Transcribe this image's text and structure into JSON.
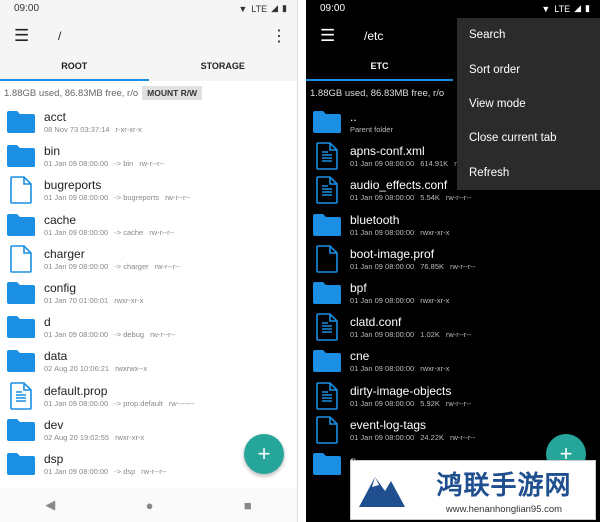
{
  "left": {
    "status_time": "09:00",
    "status_net": "LTE",
    "path": "/",
    "tabs": [
      "ROOT",
      "STORAGE"
    ],
    "storage_info": "1.88GB used, 86.83MB free, r/o",
    "mount_button": "MOUNT R/W",
    "files": [
      {
        "name": "acct",
        "type": "folder",
        "date": "08 Nov 73 03:37:14",
        "link": "",
        "perm": "r-xr-xr-x"
      },
      {
        "name": "bin",
        "type": "folder",
        "date": "01 Jan 09 08:00:00",
        "link": "-> bin",
        "perm": "rw-r--r--"
      },
      {
        "name": "bugreports",
        "type": "file",
        "date": "01 Jan 09 08:00:00",
        "link": "-> bugreports",
        "perm": "rw-r--r--"
      },
      {
        "name": "cache",
        "type": "folder",
        "date": "01 Jan 09 08:00:00",
        "link": "-> cache",
        "perm": "rw-r--r--"
      },
      {
        "name": "charger",
        "type": "file",
        "date": "01 Jan 09 08:00:00",
        "link": "-> charger",
        "perm": "rw-r--r--"
      },
      {
        "name": "config",
        "type": "folder",
        "date": "01 Jan 70 01:00:01",
        "link": "",
        "perm": "rwxr-xr-x"
      },
      {
        "name": "d",
        "type": "folder",
        "date": "01 Jan 09 08:00:00",
        "link": "-> debug",
        "perm": "rw-r--r--"
      },
      {
        "name": "data",
        "type": "folder",
        "date": "02 Aug 20 10:06:21",
        "link": "",
        "perm": "rwxrwx--x"
      },
      {
        "name": "default.prop",
        "type": "doc",
        "date": "01 Jan 09 08:00:00",
        "link": "-> prop.default",
        "perm": "rw-------"
      },
      {
        "name": "dev",
        "type": "folder",
        "date": "02 Aug 20 19:02:55",
        "link": "",
        "perm": "rwxr-xr-x"
      },
      {
        "name": "dsp",
        "type": "folder",
        "date": "01 Jan 09 08:00:00",
        "link": "-> dsp",
        "perm": "rw-r--r--"
      }
    ],
    "fab": "+",
    "nav": [
      "◀",
      "●",
      "■"
    ]
  },
  "right": {
    "status_time": "09:00",
    "status_net": "LTE",
    "path": "/etc",
    "tabs": [
      "ETC"
    ],
    "storage_info": "1.88GB used, 86.83MB free, r/o",
    "files": [
      {
        "name": "..",
        "type": "folder",
        "date": "Parent folder",
        "size": "",
        "perm": ""
      },
      {
        "name": "apns-conf.xml",
        "type": "doc",
        "date": "01 Jan 09 08:00:00",
        "size": "614.91K",
        "perm": "rw-r--r--"
      },
      {
        "name": "audio_effects.conf",
        "type": "doc",
        "date": "01 Jan 09 08:00:00",
        "size": "5.54K",
        "perm": "rw-r--r--"
      },
      {
        "name": "bluetooth",
        "type": "folder",
        "date": "01 Jan 09 08:00:00",
        "size": "",
        "perm": "rwxr-xr-x"
      },
      {
        "name": "boot-image.prof",
        "type": "file",
        "date": "01 Jan 09 08:00:00",
        "size": "76.85K",
        "perm": "rw-r--r--"
      },
      {
        "name": "bpf",
        "type": "folder",
        "date": "01 Jan 09 08:00:00",
        "size": "",
        "perm": "rwxr-xr-x"
      },
      {
        "name": "clatd.conf",
        "type": "doc",
        "date": "01 Jan 09 08:00:00",
        "size": "1.02K",
        "perm": "rw-r--r--"
      },
      {
        "name": "cne",
        "type": "folder",
        "date": "01 Jan 09 08:00:00",
        "size": "",
        "perm": "rwxr-xr-x"
      },
      {
        "name": "dirty-image-objects",
        "type": "doc",
        "date": "01 Jan 09 08:00:00",
        "size": "5.92K",
        "perm": "rw-r--r--"
      },
      {
        "name": "event-log-tags",
        "type": "file",
        "date": "01 Jan 09 08:00:00",
        "size": "24.22K",
        "perm": "rw-r--r--"
      },
      {
        "name": "firmware",
        "type": "folder",
        "date": "",
        "size": "",
        "perm": ""
      }
    ],
    "menu": [
      "Search",
      "Sort order",
      "View mode",
      "Close current tab",
      "Refresh"
    ],
    "fab": "+"
  },
  "watermark": {
    "title": "鸿联手游网",
    "url": "www.henanhonglian95.com"
  },
  "colors": {
    "folder": "#1a8fe3",
    "accent": "#1a8fe3",
    "fab": "#26a69a"
  }
}
